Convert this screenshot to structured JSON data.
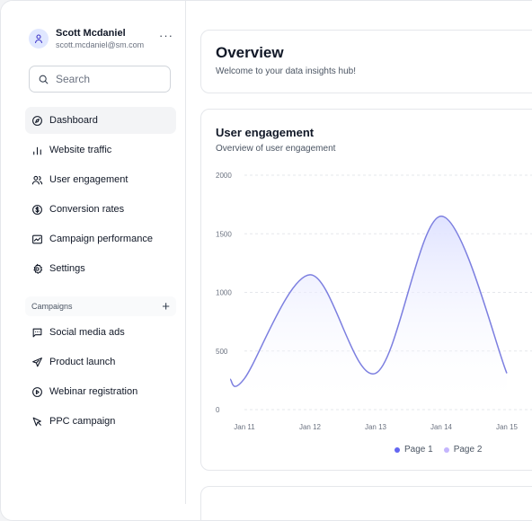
{
  "user": {
    "name": "Scott Mcdaniel",
    "email": "scott.mcdaniel@sm.com",
    "more_label": "···"
  },
  "search": {
    "placeholder": "Search"
  },
  "nav": [
    {
      "label": "Dashboard",
      "icon": "compass-icon",
      "active": true
    },
    {
      "label": "Website traffic",
      "icon": "bar-chart-icon"
    },
    {
      "label": "User engagement",
      "icon": "users-icon"
    },
    {
      "label": "Conversion rates",
      "icon": "dollar-circle-icon"
    },
    {
      "label": "Campaign performance",
      "icon": "line-chart-icon"
    },
    {
      "label": "Settings",
      "icon": "gear-icon"
    }
  ],
  "campaigns": {
    "section_label": "Campaigns",
    "add_label": "+",
    "items": [
      {
        "label": "Social media ads",
        "icon": "message-square-icon"
      },
      {
        "label": "Product launch",
        "icon": "send-icon"
      },
      {
        "label": "Webinar registration",
        "icon": "play-circle-icon"
      },
      {
        "label": "PPC campaign",
        "icon": "cursor-click-icon"
      }
    ]
  },
  "overview": {
    "title": "Overview",
    "subtitle": "Welcome to your data insights hub!"
  },
  "engagement": {
    "title": "User engagement",
    "subtitle": "Overview of user engagement"
  },
  "colors": {
    "series1": "#6366f1",
    "series2": "#c4b5fd",
    "line": "#7c7fe0",
    "fill": "#e0e3ff"
  },
  "chart_data": {
    "type": "area",
    "title": "User engagement",
    "subtitle": "Overview of user engagement",
    "categories": [
      "Jan 11",
      "Jan 12",
      "Jan 13",
      "Jan 14",
      "Jan 15"
    ],
    "x": [
      "Jan 11",
      "Jan 11",
      "Jan 12",
      "Jan 13",
      "Jan 14",
      "Jan 15"
    ],
    "ylim": [
      0,
      2000
    ],
    "yticks": [
      0,
      500,
      1000,
      1500,
      2000
    ],
    "grid": true,
    "legend_position": "bottom",
    "series": [
      {
        "name": "Page 1",
        "values": [
          260,
          1150,
          310,
          1650,
          310
        ]
      },
      {
        "name": "Page 2",
        "values": []
      }
    ]
  }
}
